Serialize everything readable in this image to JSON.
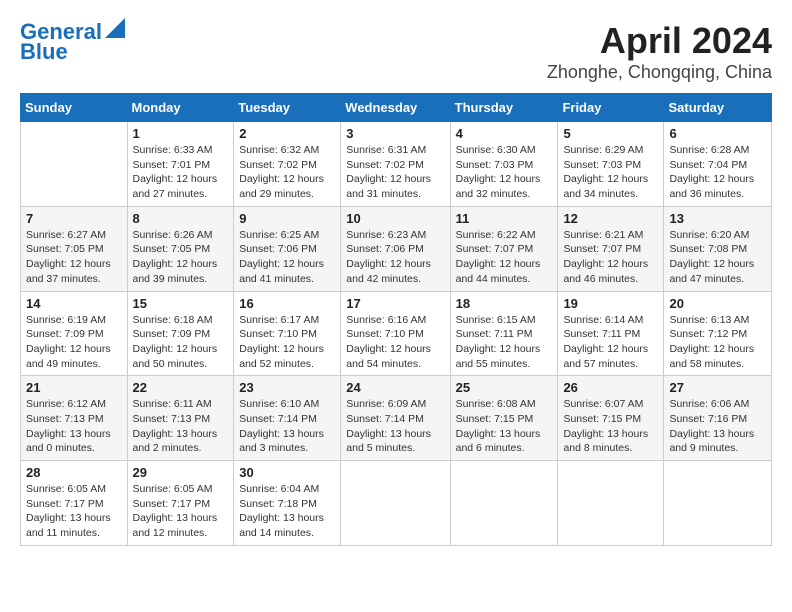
{
  "header": {
    "logo_line1": "General",
    "logo_line2": "Blue",
    "month_year": "April 2024",
    "location": "Zhonghe, Chongqing, China"
  },
  "weekdays": [
    "Sunday",
    "Monday",
    "Tuesday",
    "Wednesday",
    "Thursday",
    "Friday",
    "Saturday"
  ],
  "weeks": [
    [
      {
        "day": "",
        "sunrise": "",
        "sunset": "",
        "daylight": ""
      },
      {
        "day": "1",
        "sunrise": "Sunrise: 6:33 AM",
        "sunset": "Sunset: 7:01 PM",
        "daylight": "Daylight: 12 hours and 27 minutes."
      },
      {
        "day": "2",
        "sunrise": "Sunrise: 6:32 AM",
        "sunset": "Sunset: 7:02 PM",
        "daylight": "Daylight: 12 hours and 29 minutes."
      },
      {
        "day": "3",
        "sunrise": "Sunrise: 6:31 AM",
        "sunset": "Sunset: 7:02 PM",
        "daylight": "Daylight: 12 hours and 31 minutes."
      },
      {
        "day": "4",
        "sunrise": "Sunrise: 6:30 AM",
        "sunset": "Sunset: 7:03 PM",
        "daylight": "Daylight: 12 hours and 32 minutes."
      },
      {
        "day": "5",
        "sunrise": "Sunrise: 6:29 AM",
        "sunset": "Sunset: 7:03 PM",
        "daylight": "Daylight: 12 hours and 34 minutes."
      },
      {
        "day": "6",
        "sunrise": "Sunrise: 6:28 AM",
        "sunset": "Sunset: 7:04 PM",
        "daylight": "Daylight: 12 hours and 36 minutes."
      }
    ],
    [
      {
        "day": "7",
        "sunrise": "Sunrise: 6:27 AM",
        "sunset": "Sunset: 7:05 PM",
        "daylight": "Daylight: 12 hours and 37 minutes."
      },
      {
        "day": "8",
        "sunrise": "Sunrise: 6:26 AM",
        "sunset": "Sunset: 7:05 PM",
        "daylight": "Daylight: 12 hours and 39 minutes."
      },
      {
        "day": "9",
        "sunrise": "Sunrise: 6:25 AM",
        "sunset": "Sunset: 7:06 PM",
        "daylight": "Daylight: 12 hours and 41 minutes."
      },
      {
        "day": "10",
        "sunrise": "Sunrise: 6:23 AM",
        "sunset": "Sunset: 7:06 PM",
        "daylight": "Daylight: 12 hours and 42 minutes."
      },
      {
        "day": "11",
        "sunrise": "Sunrise: 6:22 AM",
        "sunset": "Sunset: 7:07 PM",
        "daylight": "Daylight: 12 hours and 44 minutes."
      },
      {
        "day": "12",
        "sunrise": "Sunrise: 6:21 AM",
        "sunset": "Sunset: 7:07 PM",
        "daylight": "Daylight: 12 hours and 46 minutes."
      },
      {
        "day": "13",
        "sunrise": "Sunrise: 6:20 AM",
        "sunset": "Sunset: 7:08 PM",
        "daylight": "Daylight: 12 hours and 47 minutes."
      }
    ],
    [
      {
        "day": "14",
        "sunrise": "Sunrise: 6:19 AM",
        "sunset": "Sunset: 7:09 PM",
        "daylight": "Daylight: 12 hours and 49 minutes."
      },
      {
        "day": "15",
        "sunrise": "Sunrise: 6:18 AM",
        "sunset": "Sunset: 7:09 PM",
        "daylight": "Daylight: 12 hours and 50 minutes."
      },
      {
        "day": "16",
        "sunrise": "Sunrise: 6:17 AM",
        "sunset": "Sunset: 7:10 PM",
        "daylight": "Daylight: 12 hours and 52 minutes."
      },
      {
        "day": "17",
        "sunrise": "Sunrise: 6:16 AM",
        "sunset": "Sunset: 7:10 PM",
        "daylight": "Daylight: 12 hours and 54 minutes."
      },
      {
        "day": "18",
        "sunrise": "Sunrise: 6:15 AM",
        "sunset": "Sunset: 7:11 PM",
        "daylight": "Daylight: 12 hours and 55 minutes."
      },
      {
        "day": "19",
        "sunrise": "Sunrise: 6:14 AM",
        "sunset": "Sunset: 7:11 PM",
        "daylight": "Daylight: 12 hours and 57 minutes."
      },
      {
        "day": "20",
        "sunrise": "Sunrise: 6:13 AM",
        "sunset": "Sunset: 7:12 PM",
        "daylight": "Daylight: 12 hours and 58 minutes."
      }
    ],
    [
      {
        "day": "21",
        "sunrise": "Sunrise: 6:12 AM",
        "sunset": "Sunset: 7:13 PM",
        "daylight": "Daylight: 13 hours and 0 minutes."
      },
      {
        "day": "22",
        "sunrise": "Sunrise: 6:11 AM",
        "sunset": "Sunset: 7:13 PM",
        "daylight": "Daylight: 13 hours and 2 minutes."
      },
      {
        "day": "23",
        "sunrise": "Sunrise: 6:10 AM",
        "sunset": "Sunset: 7:14 PM",
        "daylight": "Daylight: 13 hours and 3 minutes."
      },
      {
        "day": "24",
        "sunrise": "Sunrise: 6:09 AM",
        "sunset": "Sunset: 7:14 PM",
        "daylight": "Daylight: 13 hours and 5 minutes."
      },
      {
        "day": "25",
        "sunrise": "Sunrise: 6:08 AM",
        "sunset": "Sunset: 7:15 PM",
        "daylight": "Daylight: 13 hours and 6 minutes."
      },
      {
        "day": "26",
        "sunrise": "Sunrise: 6:07 AM",
        "sunset": "Sunset: 7:15 PM",
        "daylight": "Daylight: 13 hours and 8 minutes."
      },
      {
        "day": "27",
        "sunrise": "Sunrise: 6:06 AM",
        "sunset": "Sunset: 7:16 PM",
        "daylight": "Daylight: 13 hours and 9 minutes."
      }
    ],
    [
      {
        "day": "28",
        "sunrise": "Sunrise: 6:05 AM",
        "sunset": "Sunset: 7:17 PM",
        "daylight": "Daylight: 13 hours and 11 minutes."
      },
      {
        "day": "29",
        "sunrise": "Sunrise: 6:05 AM",
        "sunset": "Sunset: 7:17 PM",
        "daylight": "Daylight: 13 hours and 12 minutes."
      },
      {
        "day": "30",
        "sunrise": "Sunrise: 6:04 AM",
        "sunset": "Sunset: 7:18 PM",
        "daylight": "Daylight: 13 hours and 14 minutes."
      },
      {
        "day": "",
        "sunrise": "",
        "sunset": "",
        "daylight": ""
      },
      {
        "day": "",
        "sunrise": "",
        "sunset": "",
        "daylight": ""
      },
      {
        "day": "",
        "sunrise": "",
        "sunset": "",
        "daylight": ""
      },
      {
        "day": "",
        "sunrise": "",
        "sunset": "",
        "daylight": ""
      }
    ]
  ]
}
